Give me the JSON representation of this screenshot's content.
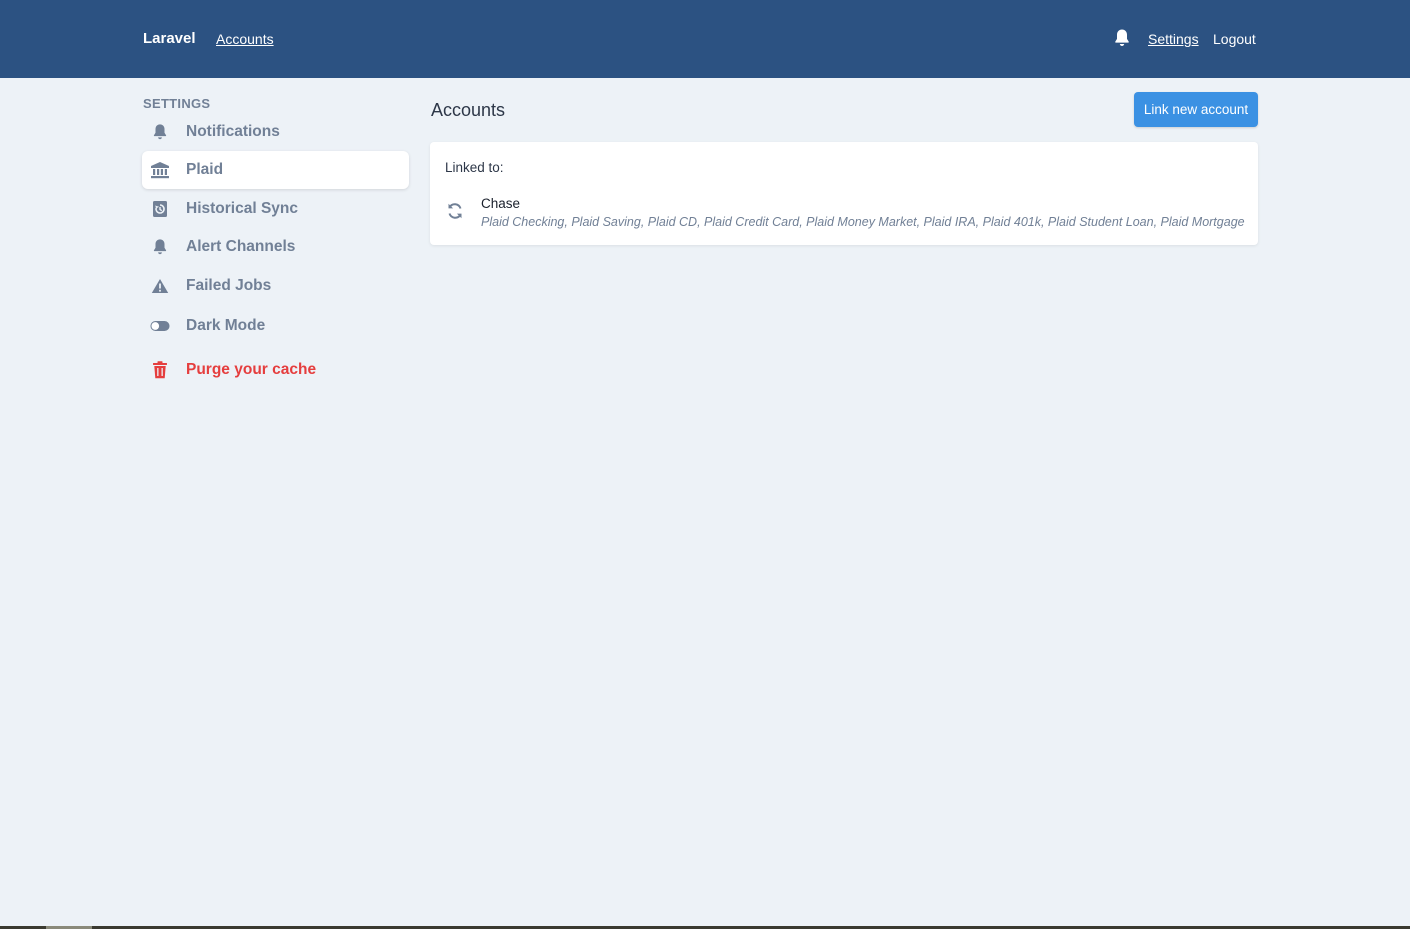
{
  "header": {
    "brand": "Laravel",
    "nav_accounts": "Accounts",
    "notification_icon": "bell-icon",
    "nav_settings": "Settings",
    "nav_logout": "Logout",
    "bg_color": "#2c5282"
  },
  "sidebar": {
    "heading": "SETTINGS",
    "items": [
      {
        "label": "Notifications",
        "icon": "bell-icon",
        "active": false
      },
      {
        "label": "Plaid",
        "icon": "bank-icon",
        "active": true
      },
      {
        "label": "Historical Sync",
        "icon": "history-icon",
        "active": false
      },
      {
        "label": "Alert Channels",
        "icon": "bell-icon",
        "active": false
      },
      {
        "label": "Failed Jobs",
        "icon": "warning-icon",
        "active": false
      },
      {
        "label": "Dark Mode",
        "icon": "toggle-icon",
        "active": false
      },
      {
        "label": "Purge your cache",
        "icon": "trash-icon",
        "active": false,
        "danger": true
      }
    ]
  },
  "main": {
    "title": "Accounts",
    "link_button": "Link new account",
    "linked_label": "Linked to:",
    "institutions": [
      {
        "name": "Chase",
        "icon": "sync-icon",
        "accounts": "Plaid Checking, Plaid Saving, Plaid CD, Plaid Credit Card, Plaid Money Market, Plaid IRA, Plaid 401k, Plaid Student Loan, Plaid Mortgage"
      }
    ]
  },
  "colors": {
    "accent": "#3b91e3",
    "danger": "#e53e3e",
    "muted": "#718096",
    "background": "#edf2f7"
  }
}
